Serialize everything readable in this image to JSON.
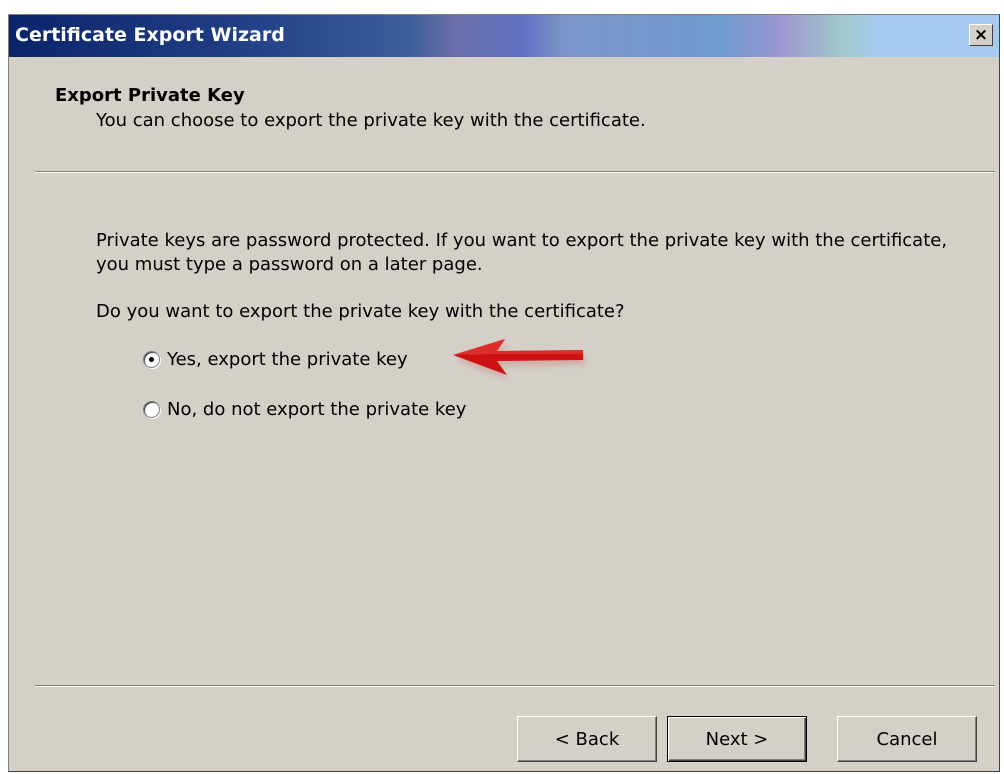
{
  "window": {
    "title": "Certificate Export Wizard",
    "close_symbol": "×"
  },
  "header": {
    "title": "Export Private Key",
    "subtitle": "You can choose to export the private key with the certificate."
  },
  "body": {
    "paragraph": "Private keys are password protected. If you want to export the private key with the certificate, you must type a password on a later page.",
    "question": "Do you want to export the private key with the certificate?",
    "options": [
      {
        "label": "Yes, export the private key",
        "selected": true
      },
      {
        "label": "No, do not export the private key",
        "selected": false
      }
    ]
  },
  "annotation": {
    "icon": "red-arrow-icon",
    "color": "#cc1111"
  },
  "buttons": {
    "back": "< Back",
    "next": "Next >",
    "cancel": "Cancel"
  }
}
